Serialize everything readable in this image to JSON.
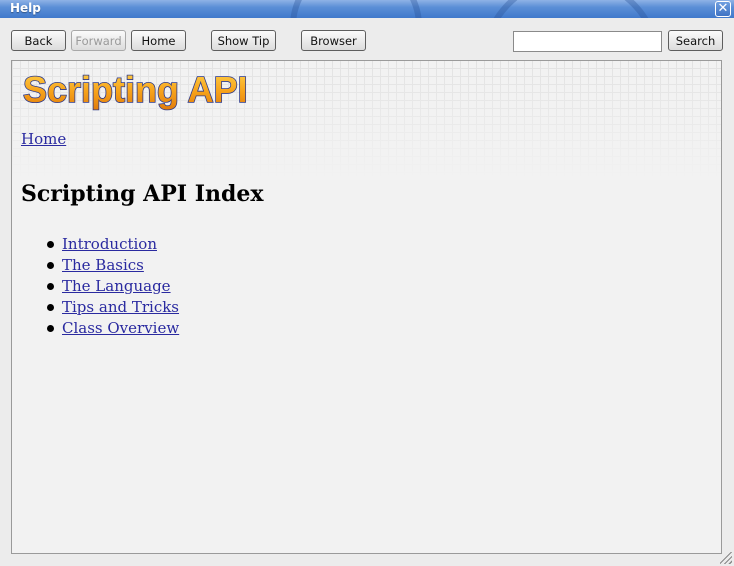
{
  "window": {
    "title": "Help",
    "close_glyph": "✕"
  },
  "toolbar": {
    "back_label": "Back",
    "forward_label": "Forward",
    "home_label": "Home",
    "show_tip_label": "Show Tip",
    "browser_label": "Browser",
    "search_label": "Search",
    "search_value": "",
    "search_placeholder": ""
  },
  "content": {
    "logo_text": "Scripting API",
    "breadcrumb": {
      "home": "Home"
    },
    "heading": "Scripting API Index",
    "toc": [
      {
        "label": "Introduction"
      },
      {
        "label": "The Basics"
      },
      {
        "label": "The Language"
      },
      {
        "label": "Tips and Tricks"
      },
      {
        "label": "Class Overview"
      }
    ]
  },
  "colors": {
    "title_bar": "#4f85d1",
    "link": "#2a2aa0",
    "logo_fill": "#f7a21a",
    "logo_outline": "#2d3a8c"
  }
}
